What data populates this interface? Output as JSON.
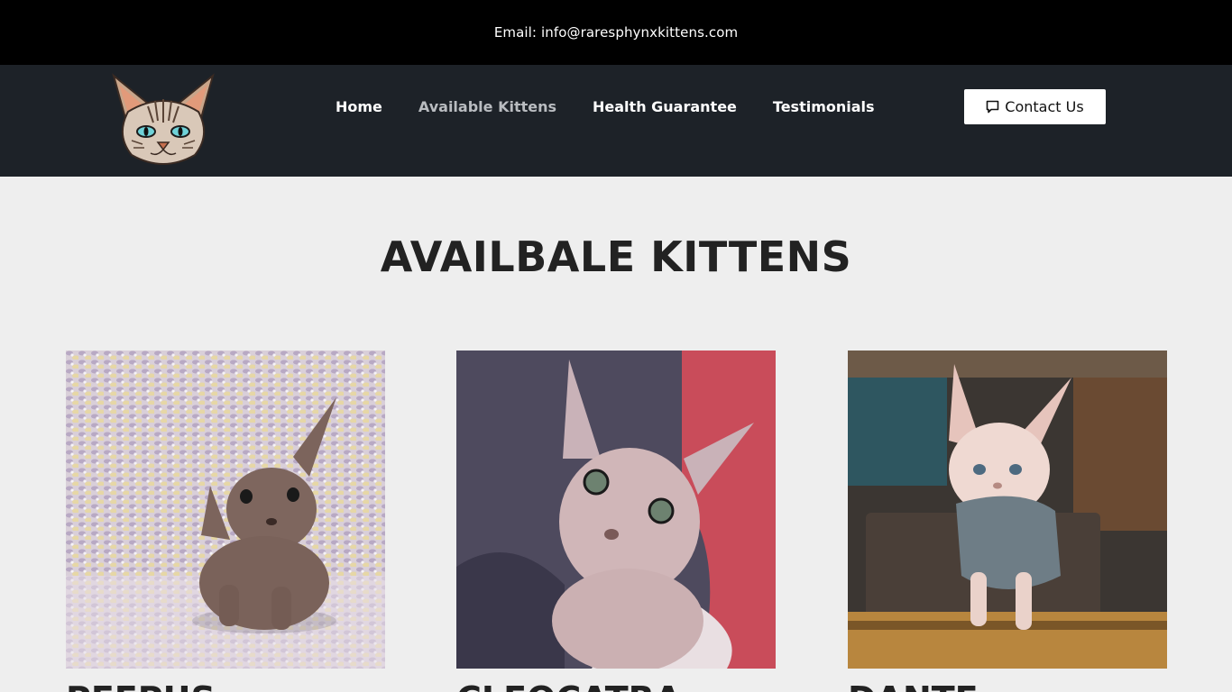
{
  "topbar": {
    "email": "Email: info@raresphynxkittens.com"
  },
  "header": {
    "logo_icon": "sphynx-cat-logo",
    "nav": [
      {
        "label": "Home",
        "active": false
      },
      {
        "label": "Available Kittens",
        "active": true
      },
      {
        "label": "Health Guarantee",
        "active": false
      },
      {
        "label": "Testimonials",
        "active": false
      }
    ],
    "contact_label": "Contact Us",
    "contact_icon": "chat-icon"
  },
  "main": {
    "title": "AVAILBALE KITTENS",
    "kittens": [
      {
        "name": "PEEPUS",
        "photo": "brown-sphynx-kitten-photo"
      },
      {
        "name": "CLEOCATRA",
        "photo": "lilac-sphynx-kitten-photo"
      },
      {
        "name": "DANTE",
        "photo": "cream-sphynx-kitten-photo"
      }
    ]
  },
  "colors": {
    "topbar_bg": "#000000",
    "navbar_bg": "#1d2228",
    "page_bg": "#eeeeee",
    "nav_active": "#b9bcc0"
  }
}
